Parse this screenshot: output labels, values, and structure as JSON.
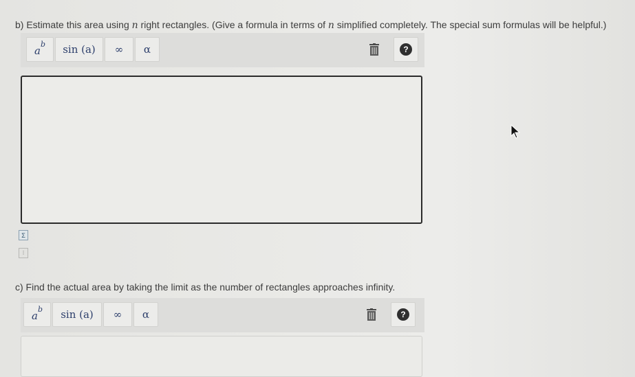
{
  "part_b": {
    "text_before": "b) Estimate this area using ",
    "var_n1": "n",
    "text_middle": " right rectangles. (Give a formula in terms of ",
    "var_n2": "n",
    "text_after": " simplified completely. The special sum formulas will be helpful.)"
  },
  "part_c": {
    "text": "c) Find the actual area by taking the limit as the number of rectangles approaches infinity."
  },
  "toolbar": {
    "power_base": "a",
    "power_exp": "b",
    "sin_label": "sin (a)",
    "infinity_label": "∞",
    "alpha_label": "α",
    "help_label": "?"
  },
  "side_icons": {
    "sum_label": "Σ",
    "matrix_label": "⁝"
  },
  "colors": {
    "box_border": "#2a2a2a",
    "symbol_text": "#2c3e6b"
  }
}
